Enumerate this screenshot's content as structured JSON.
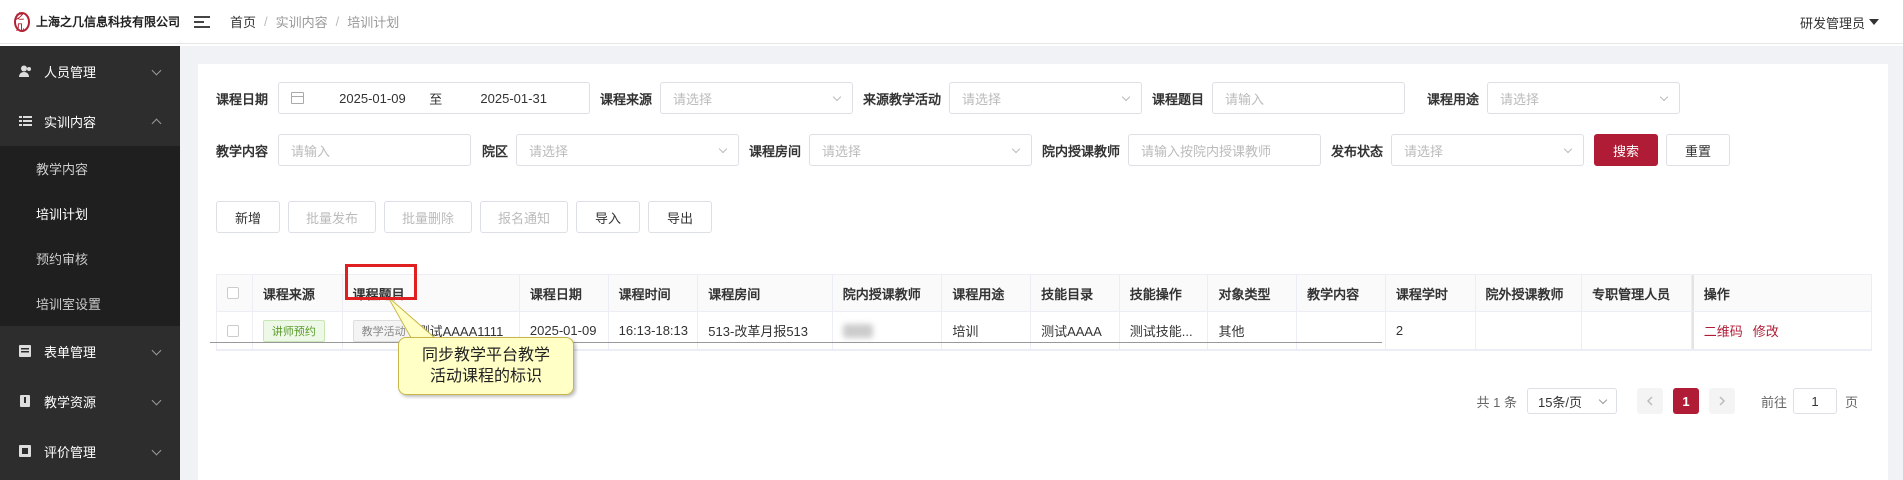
{
  "header": {
    "logo_mark": "之几",
    "company": "上海之几信息科技有限公司",
    "breadcrumb": [
      "首页",
      "实训内容",
      "培训计划"
    ],
    "user": "研发管理员"
  },
  "sidebar": {
    "items": [
      {
        "label": "人员管理",
        "icon": "user-icon"
      },
      {
        "label": "实训内容",
        "icon": "list-icon",
        "expanded": true,
        "children": [
          "教学内容",
          "培训计划",
          "预约审核",
          "培训室设置"
        ],
        "active_child": "培训计划"
      },
      {
        "label": "表单管理",
        "icon": "form-icon"
      },
      {
        "label": "教学资源",
        "icon": "book-icon"
      },
      {
        "label": "评价管理",
        "icon": "rating-icon"
      }
    ]
  },
  "filters": {
    "course_date_label": "课程日期",
    "date_start": "2025-01-09",
    "date_to": "至",
    "date_end": "2025-01-31",
    "course_source_label": "课程来源",
    "course_source_ph": "请选择",
    "source_activity_label": "来源教学活动",
    "source_activity_ph": "请选择",
    "course_topic_label": "课程题目",
    "course_topic_ph": "请输入",
    "course_use_label": "课程用途",
    "course_use_ph": "请选择",
    "teaching_content_label": "教学内容",
    "teaching_content_ph": "请输入",
    "campus_label": "院区",
    "campus_ph": "请选择",
    "room_label": "课程房间",
    "room_ph": "请选择",
    "inner_teacher_label": "院内授课教师",
    "inner_teacher_ph": "请输入按院内授课教师",
    "publish_status_label": "发布状态",
    "publish_status_ph": "请选择",
    "search": "搜索",
    "reset": "重置"
  },
  "toolbar": {
    "add": "新增",
    "batch_publish": "批量发布",
    "batch_delete": "批量删除",
    "signup_notice": "报名通知",
    "import": "导入",
    "export": "导出"
  },
  "table": {
    "columns": [
      "课程来源",
      "课程题目",
      "课程日期",
      "课程时间",
      "课程房间",
      "院内授课教师",
      "课程用途",
      "技能目录",
      "技能操作",
      "对象类型",
      "教学内容",
      "课程学时",
      "院外授课教师",
      "专职管理人员",
      "操作"
    ],
    "rows": [
      {
        "source_tag": "讲师预约",
        "activity_tag": "教学活动",
        "topic": "测试AAAA1111",
        "date": "2025-01-09",
        "time": "16:13-18:13",
        "room": "513-改革月报513",
        "inner_teacher": "",
        "use": "培训",
        "skill_dir": "测试AAAA",
        "skill_op": "测试技能...",
        "object_type": "其他",
        "content": "",
        "hours": "2",
        "outer_teacher": "",
        "manager": "",
        "action_qrcode": "二维码",
        "action_edit": "修改"
      }
    ]
  },
  "annotation": {
    "text": "同步教学平台教学\n活动课程的标识"
  },
  "pagination": {
    "total": "共 1 条",
    "page_size": "15条/页",
    "current": "1",
    "goto_label": "前往",
    "goto_value": "1",
    "page_suffix": "页"
  }
}
